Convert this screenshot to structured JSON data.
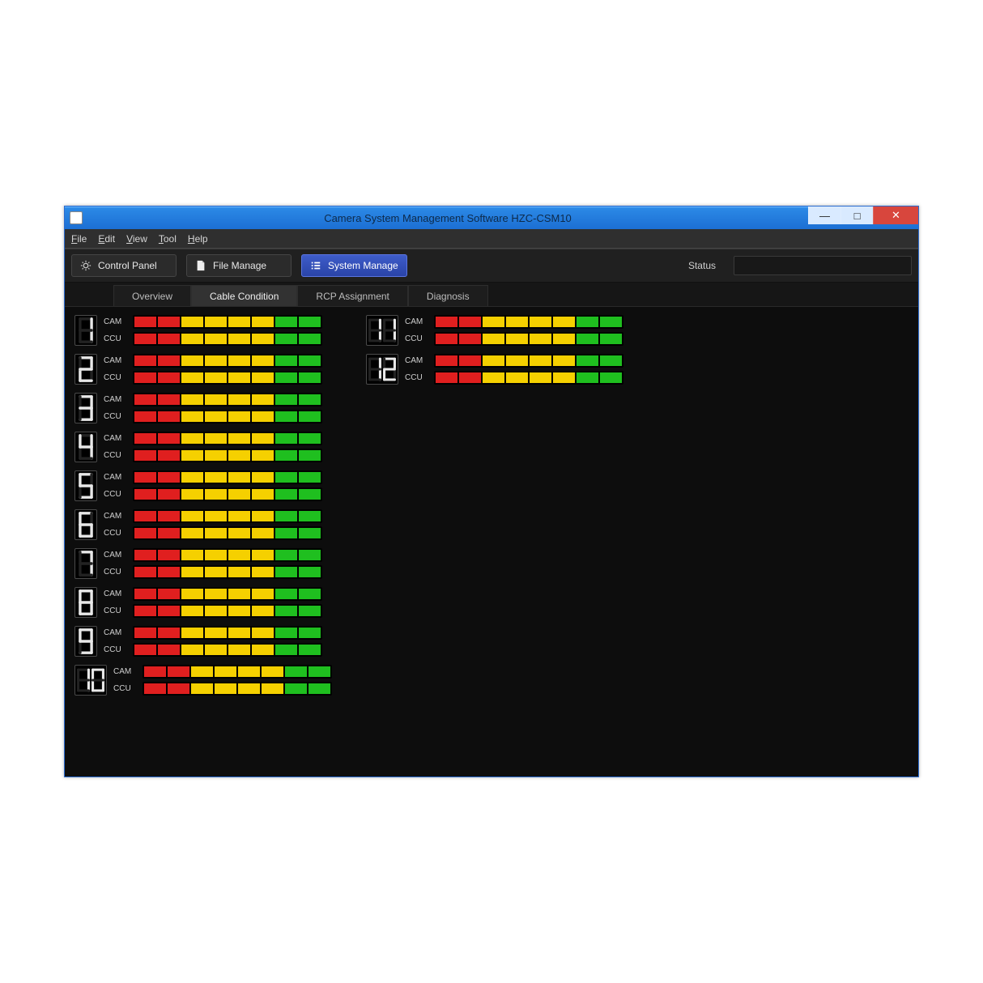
{
  "window": {
    "title": "Camera System Management Software HZC-CSM10"
  },
  "menubar": [
    "File",
    "Edit",
    "View",
    "Tool",
    "Help"
  ],
  "toolbar": {
    "control_panel": "Control Panel",
    "file_manage": "File Manage",
    "system_manage": "System Manage",
    "status_label": "Status",
    "active": "system_manage"
  },
  "subtabs": {
    "items": [
      "Overview",
      "Cable Condition",
      "RCP Assignment",
      "Diagnosis"
    ],
    "active_index": 1
  },
  "row_labels": {
    "cam": "CAM",
    "ccu": "CCU"
  },
  "meter_colors": {
    "r": "#e01f1f",
    "y": "#f5d000",
    "g": "#1fbf1f"
  },
  "channels": [
    {
      "num": 1,
      "cam": [
        "r",
        "r",
        "y",
        "y",
        "y",
        "y",
        "g",
        "g"
      ],
      "ccu": [
        "r",
        "r",
        "y",
        "y",
        "y",
        "y",
        "g",
        "g"
      ]
    },
    {
      "num": 2,
      "cam": [
        "r",
        "r",
        "y",
        "y",
        "y",
        "y",
        "g",
        "g"
      ],
      "ccu": [
        "r",
        "r",
        "y",
        "y",
        "y",
        "y",
        "g",
        "g"
      ]
    },
    {
      "num": 3,
      "cam": [
        "r",
        "r",
        "y",
        "y",
        "y",
        "y",
        "g",
        "g"
      ],
      "ccu": [
        "r",
        "r",
        "y",
        "y",
        "y",
        "y",
        "g",
        "g"
      ]
    },
    {
      "num": 4,
      "cam": [
        "r",
        "r",
        "y",
        "y",
        "y",
        "y",
        "g",
        "g"
      ],
      "ccu": [
        "r",
        "r",
        "y",
        "y",
        "y",
        "y",
        "g",
        "g"
      ]
    },
    {
      "num": 5,
      "cam": [
        "r",
        "r",
        "y",
        "y",
        "y",
        "y",
        "g",
        "g"
      ],
      "ccu": [
        "r",
        "r",
        "y",
        "y",
        "y",
        "y",
        "g",
        "g"
      ]
    },
    {
      "num": 6,
      "cam": [
        "r",
        "r",
        "y",
        "y",
        "y",
        "y",
        "g",
        "g"
      ],
      "ccu": [
        "r",
        "r",
        "y",
        "y",
        "y",
        "y",
        "g",
        "g"
      ]
    },
    {
      "num": 7,
      "cam": [
        "r",
        "r",
        "y",
        "y",
        "y",
        "y",
        "g",
        "g"
      ],
      "ccu": [
        "r",
        "r",
        "y",
        "y",
        "y",
        "y",
        "g",
        "g"
      ]
    },
    {
      "num": 8,
      "cam": [
        "r",
        "r",
        "y",
        "y",
        "y",
        "y",
        "g",
        "g"
      ],
      "ccu": [
        "r",
        "r",
        "y",
        "y",
        "y",
        "y",
        "g",
        "g"
      ]
    },
    {
      "num": 9,
      "cam": [
        "r",
        "r",
        "y",
        "y",
        "y",
        "y",
        "g",
        "g"
      ],
      "ccu": [
        "r",
        "r",
        "y",
        "y",
        "y",
        "y",
        "g",
        "g"
      ]
    },
    {
      "num": 10,
      "cam": [
        "r",
        "r",
        "y",
        "y",
        "y",
        "y",
        "g",
        "g"
      ],
      "ccu": [
        "r",
        "r",
        "y",
        "y",
        "y",
        "y",
        "g",
        "g"
      ]
    },
    {
      "num": 11,
      "cam": [
        "r",
        "r",
        "y",
        "y",
        "y",
        "y",
        "g",
        "g"
      ],
      "ccu": [
        "r",
        "r",
        "y",
        "y",
        "y",
        "y",
        "g",
        "g"
      ]
    },
    {
      "num": 12,
      "cam": [
        "r",
        "r",
        "y",
        "y",
        "y",
        "y",
        "g",
        "g"
      ],
      "ccu": [
        "r",
        "r",
        "y",
        "y",
        "y",
        "y",
        "g",
        "g"
      ]
    }
  ]
}
